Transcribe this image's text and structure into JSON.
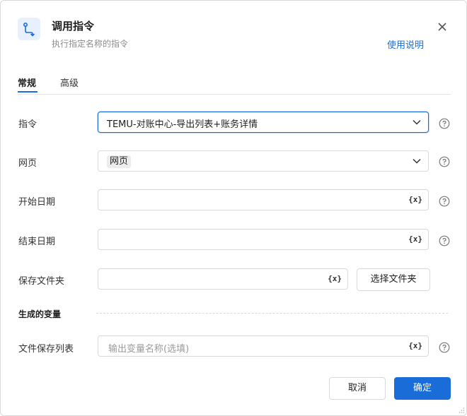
{
  "header": {
    "title": "调用指令",
    "subtitle": "执行指定名称的指令",
    "help_link": "使用说明",
    "icon": "route-icon"
  },
  "tabs": [
    {
      "label": "常规",
      "active": true
    },
    {
      "label": "高级",
      "active": false
    }
  ],
  "form": {
    "command": {
      "label": "指令",
      "value": "TEMU-对账中心-导出列表+账务详情"
    },
    "webpage": {
      "label": "网页",
      "value": "网页"
    },
    "start_date": {
      "label": "开始日期",
      "value": "",
      "var_button": "{x}"
    },
    "end_date": {
      "label": "结束日期",
      "value": "",
      "var_button": "{x}"
    },
    "save_folder": {
      "label": "保存文件夹",
      "value": "",
      "var_button": "{x}",
      "button": "选择文件夹"
    }
  },
  "generated_vars": {
    "section_title": "生成的变量",
    "file_list": {
      "label": "文件保存列表",
      "placeholder": "输出变量名称(选填)",
      "var_button": "{x}"
    }
  },
  "footer": {
    "cancel": "取消",
    "ok": "确定"
  },
  "colors": {
    "accent": "#1a6dd9",
    "icon_bg": "#e8f0fe"
  }
}
